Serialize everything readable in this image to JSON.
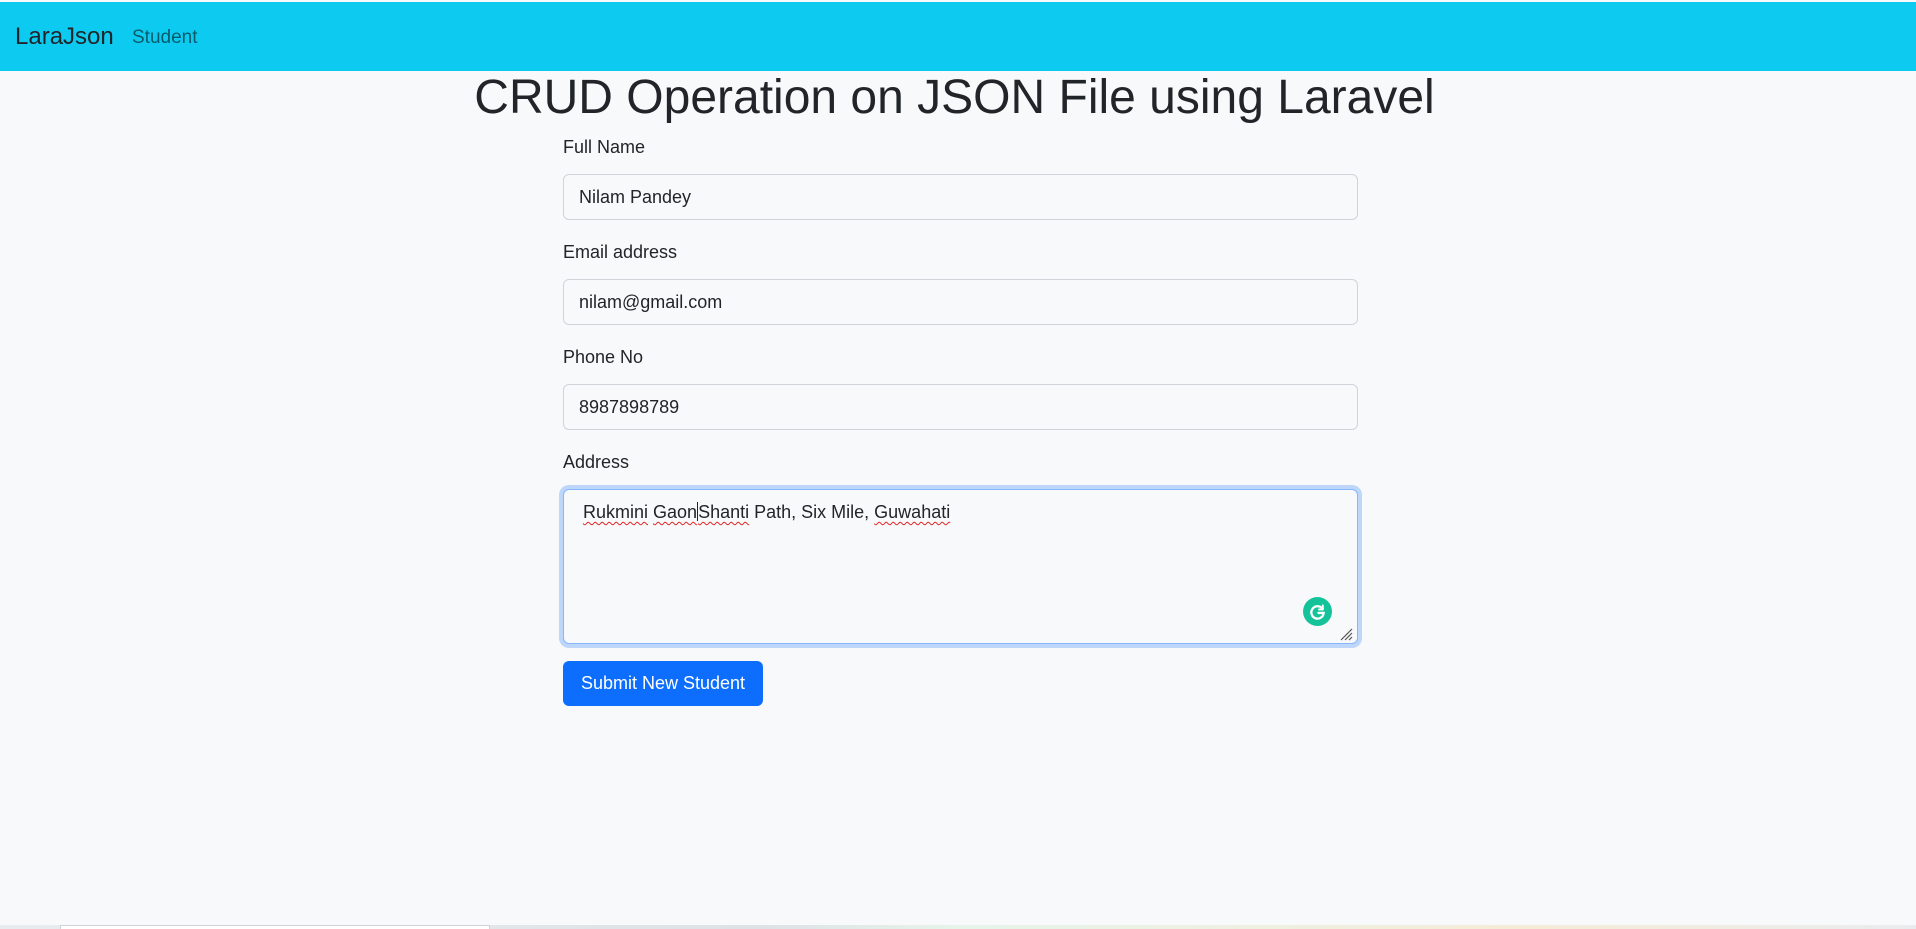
{
  "navbar": {
    "brand": "LaraJson",
    "links": [
      {
        "label": "Student"
      }
    ],
    "bg_color": "#0dcaf0"
  },
  "page": {
    "title": "CRUD Operation on JSON File using Laravel"
  },
  "form": {
    "full_name": {
      "label": "Full Name",
      "value": "Nilam Pandey"
    },
    "email": {
      "label": "Email address",
      "value": "nilam@gmail.com"
    },
    "phone": {
      "label": "Phone No",
      "value": "8987898789"
    },
    "address": {
      "label": "Address",
      "value_parts": [
        "Rukmini",
        " ",
        "Gaon",
        "Shanti",
        " Path, Six Mile, ",
        "Guwahati"
      ]
    },
    "submit_label": "Submit New Student",
    "submit_color": "#0d6efd"
  },
  "icons": {
    "grammarly": "grammarly-icon",
    "resize": "resize-handle-icon"
  }
}
